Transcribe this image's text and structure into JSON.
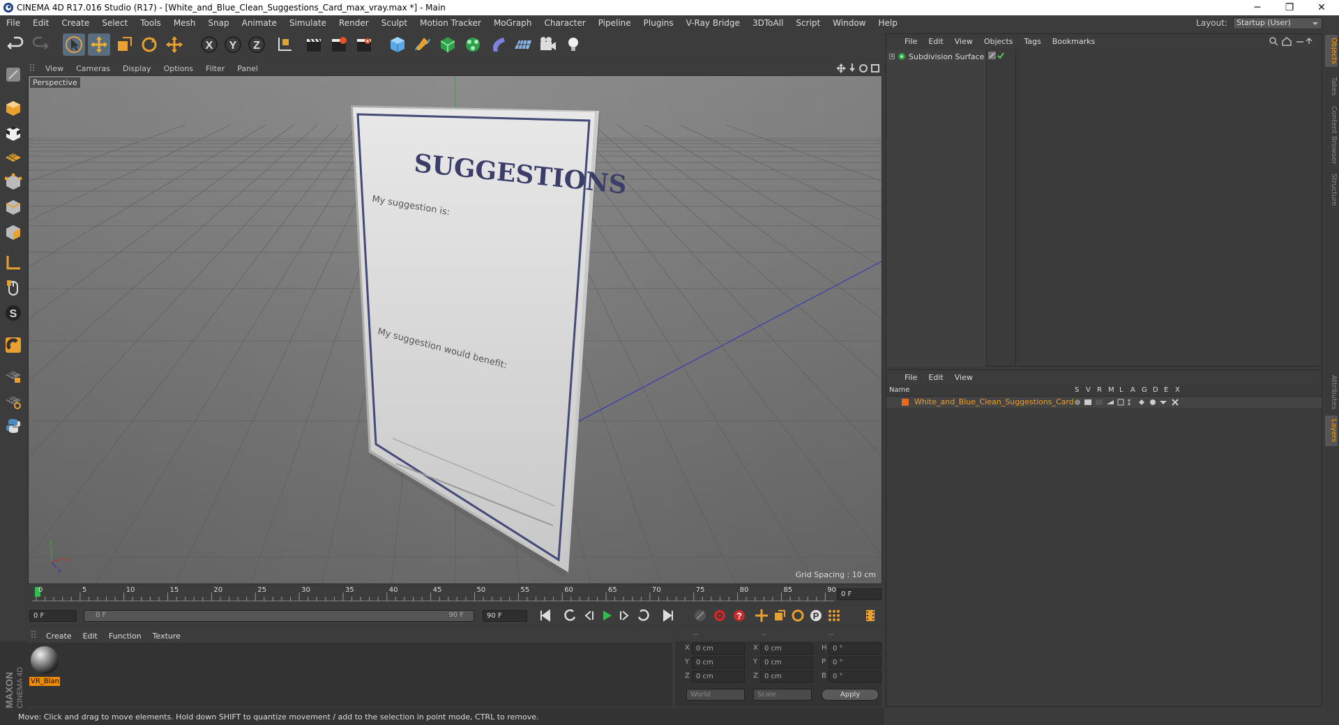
{
  "window": {
    "title": "CINEMA 4D R17.016 Studio (R17) - [White_and_Blue_Clean_Suggestions_Card_max_vray.max *] - Main",
    "min": "─",
    "max": "❐",
    "close": "✕"
  },
  "menu": [
    "File",
    "Edit",
    "Create",
    "Select",
    "Tools",
    "Mesh",
    "Snap",
    "Animate",
    "Simulate",
    "Render",
    "Sculpt",
    "Motion Tracker",
    "MoGraph",
    "Character",
    "Pipeline",
    "Plugins",
    "V-Ray Bridge",
    "3DToAll",
    "Script",
    "Window",
    "Help"
  ],
  "layout": {
    "label": "Layout:",
    "value": "Startup (User)"
  },
  "viewport": {
    "menu": [
      "View",
      "Cameras",
      "Display",
      "Options",
      "Filter",
      "Panel"
    ],
    "camera_label": "Perspective",
    "grid_spacing": "Grid Spacing : 10 cm",
    "card": {
      "heading": "SUGGESTIONS",
      "line1": "My suggestion is:",
      "line2": "My suggestion would benefit:"
    }
  },
  "timeline": {
    "ticks": [
      "0",
      "5",
      "10",
      "15",
      "20",
      "25",
      "30",
      "35",
      "40",
      "45",
      "50",
      "55",
      "60",
      "65",
      "70",
      "75",
      "80",
      "85",
      "90"
    ],
    "current_frame": "0 F",
    "start_field": "0 F",
    "range_start": "0 F",
    "range_end": "90 F",
    "end_field": "90 F"
  },
  "material": {
    "menu": [
      "Create",
      "Edit",
      "Function",
      "Texture"
    ],
    "item_label": "VR_Blan"
  },
  "coords": {
    "header": [
      "--",
      "--",
      "--"
    ],
    "rows": [
      {
        "a": "X",
        "av": "0 cm",
        "b": "X",
        "bv": "0 cm",
        "c": "H",
        "cv": "0 °"
      },
      {
        "a": "Y",
        "av": "0 cm",
        "b": "Y",
        "bv": "0 cm",
        "c": "P",
        "cv": "0 °"
      },
      {
        "a": "Z",
        "av": "0 cm",
        "b": "Z",
        "bv": "0 cm",
        "c": "B",
        "cv": "0 °"
      }
    ],
    "world": "World",
    "scale": "Scale",
    "apply": "Apply"
  },
  "status": "Move: Click and drag to move elements. Hold down SHIFT to quantize movement / add to the selection in point mode, CTRL to remove.",
  "objects": {
    "menu": [
      "File",
      "Edit",
      "View",
      "Objects",
      "Tags",
      "Bookmarks"
    ],
    "item": "Subdivision Surface"
  },
  "layers": {
    "menu": [
      "File",
      "Edit",
      "View"
    ],
    "header_name": "Name",
    "cols": [
      "S",
      "V",
      "R",
      "M",
      "L",
      "A",
      "G",
      "D",
      "E",
      "X"
    ],
    "item": "White_and_Blue_Clean_Suggestions_Card"
  },
  "side_tabs": [
    "Objects",
    "Takes",
    "Content Browser",
    "Structure",
    "Attributes",
    "Layers"
  ],
  "maxon": {
    "brand": "MAXON",
    "product": "CINEMA 4D"
  }
}
